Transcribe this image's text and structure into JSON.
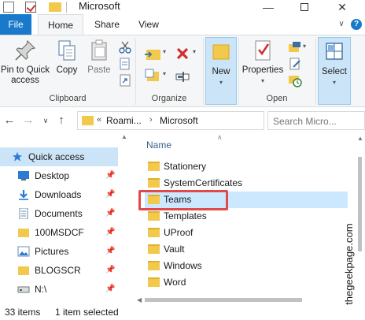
{
  "window": {
    "title": "Microsoft",
    "controls": {
      "minimize": "—",
      "close": "✕"
    }
  },
  "tabs": [
    {
      "label": "File"
    },
    {
      "label": "Home"
    },
    {
      "label": "Share"
    },
    {
      "label": "View"
    }
  ],
  "ribbon": {
    "clipboard": {
      "group_label": "Clipboard",
      "pin_label_1": "Pin to Quick",
      "pin_label_2": "access",
      "copy_label": "Copy",
      "paste_label": "Paste"
    },
    "organize": {
      "group_label": "Organize"
    },
    "new": {
      "new_label": "New"
    },
    "open": {
      "group_label": "Open",
      "properties_label": "Properties"
    },
    "select": {
      "select_label": "Select"
    }
  },
  "address": {
    "overflow": "«",
    "crumbs": [
      "Roami...",
      "Microsoft"
    ],
    "search_placeholder": "Search Micro..."
  },
  "navpane": {
    "items": [
      {
        "label": "Quick access",
        "icon": "star-icon",
        "pinned": false
      },
      {
        "label": "Desktop",
        "icon": "desktop-icon",
        "pinned": true
      },
      {
        "label": "Downloads",
        "icon": "download-icon",
        "pinned": true
      },
      {
        "label": "Documents",
        "icon": "documents-icon",
        "pinned": true
      },
      {
        "label": "100MSDCF",
        "icon": "folder-icon",
        "pinned": true
      },
      {
        "label": "Pictures",
        "icon": "pictures-icon",
        "pinned": true
      },
      {
        "label": "BLOGSCR",
        "icon": "folder-icon",
        "pinned": true
      },
      {
        "label": "N:\\",
        "icon": "drive-icon",
        "pinned": true
      }
    ]
  },
  "content": {
    "column_header": "Name",
    "rows": [
      {
        "label": "Stationery"
      },
      {
        "label": "SystemCertificates"
      },
      {
        "label": "Teams"
      },
      {
        "label": "Templates"
      },
      {
        "label": "UProof"
      },
      {
        "label": "Vault"
      },
      {
        "label": "Windows"
      },
      {
        "label": "Word"
      }
    ],
    "selected_row": "Teams"
  },
  "watermark": "@thegeekpage.com",
  "status": {
    "item_count": "33 items",
    "selection": "1 item selected"
  },
  "colors": {
    "accent": "#1979ca",
    "selection": "#cce4f7",
    "folder": "#f2c94c",
    "highlight_box": "#e04a4a"
  }
}
